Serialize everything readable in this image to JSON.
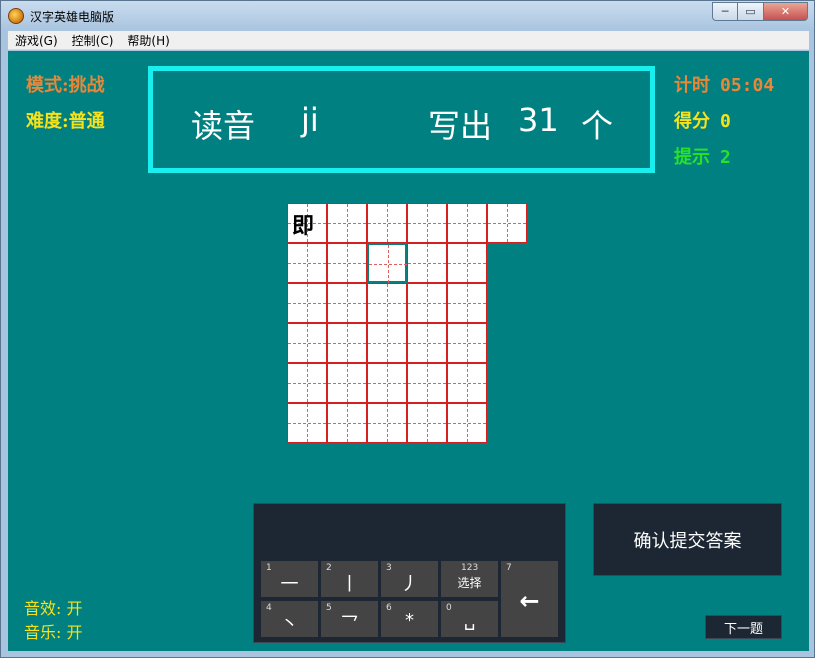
{
  "window": {
    "title": "汉字英雄电脑版",
    "minimize": "─",
    "maximize": "▭",
    "close": "✕"
  },
  "menu": [
    "游戏(G)",
    "控制(C)",
    "帮助(H)"
  ],
  "status": {
    "mode": "模式:挑战",
    "difficulty": "难度:普通",
    "timer_label": "计时",
    "timer_value": "05:04",
    "score_label": "得分",
    "score_value": "0",
    "hint_label": "提示",
    "hint_value": "2"
  },
  "banner": {
    "reading_label": "读音",
    "pinyin": "ji",
    "write_label": "写出",
    "count": "31",
    "unit": "个"
  },
  "grid": {
    "filled": [
      "即"
    ],
    "total_cells": 31,
    "active_index": 8
  },
  "keypad": {
    "keys": [
      {
        "num": "1",
        "label": "一"
      },
      {
        "num": "2",
        "label": "丨"
      },
      {
        "num": "3",
        "label": "丿"
      },
      {
        "num": "123",
        "label": "选择"
      },
      {
        "num": "7",
        "label": "←"
      },
      {
        "num": "4",
        "label": "丶"
      },
      {
        "num": "5",
        "label": "乛"
      },
      {
        "num": "6",
        "label": "*"
      },
      {
        "num": "0",
        "label": "␣"
      }
    ]
  },
  "buttons": {
    "submit": "确认提交答案",
    "next": "下一题"
  },
  "sound": {
    "sfx": "音效: 开",
    "music": "音乐: 开"
  },
  "colors": {
    "background": "#008080",
    "banner_border": "#18f0f0",
    "grid_border": "#d62020",
    "mode": "#e6883a",
    "difficulty": "#f6e21b",
    "hint": "#27e227"
  }
}
